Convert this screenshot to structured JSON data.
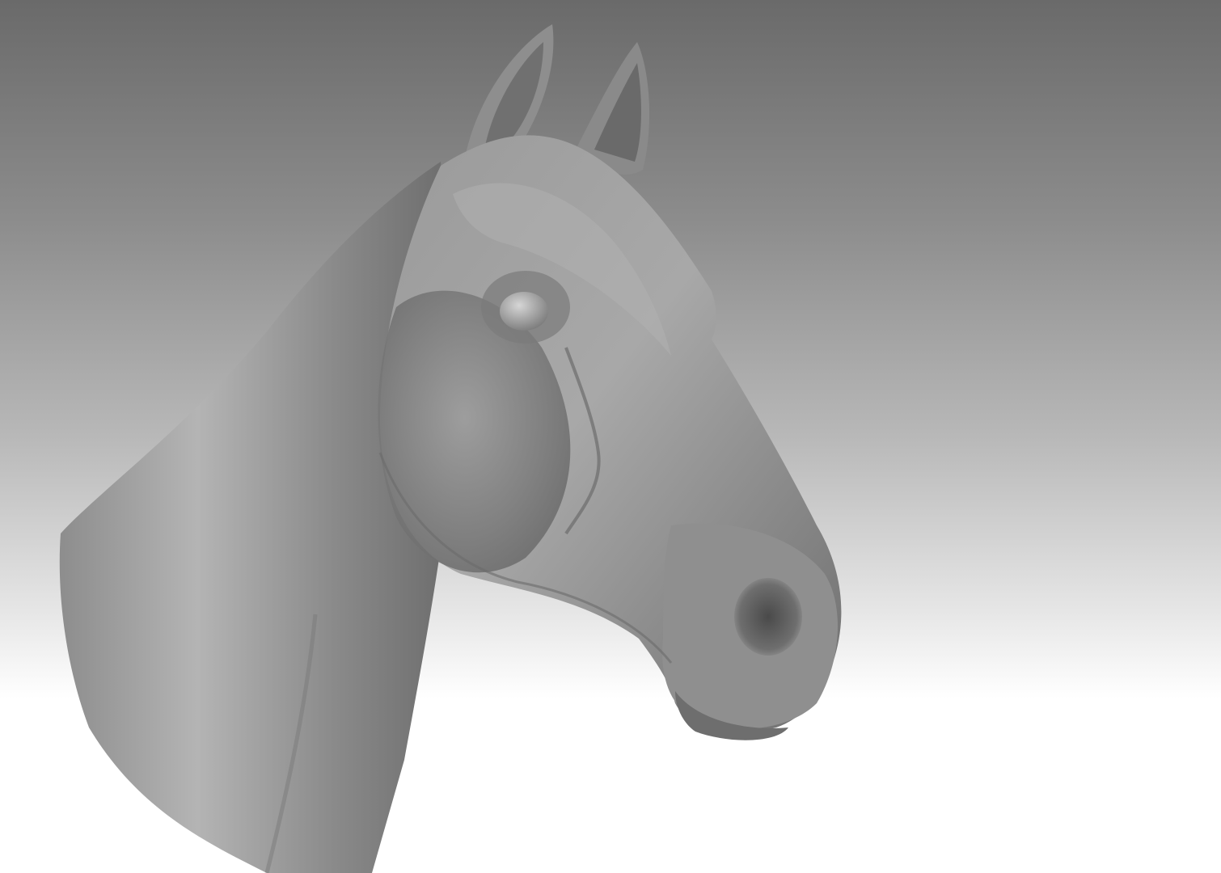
{
  "scene": {
    "subject": "horse-head-sculpt",
    "background_top_color": "#6a6a6a",
    "background_bottom_color": "#ffffff",
    "material_color": "#8a8a8a"
  }
}
